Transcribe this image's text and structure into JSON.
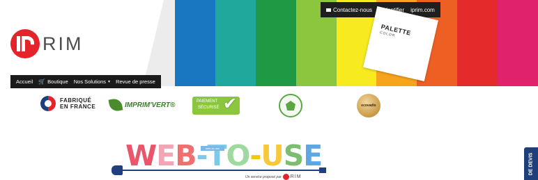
{
  "top_bar": {
    "contact": "Contactez-nous",
    "login": "S'identifier",
    "site": "iprim.com"
  },
  "logo": {
    "text": "RIM"
  },
  "palette": {
    "title": "PALETTE",
    "subtitle": "COLOR"
  },
  "stripe_colors": [
    "#1976c0",
    "#1fa89c",
    "#1f9943",
    "#8cc63f",
    "#f7ea1f",
    "#f7a41d",
    "#ee5f24",
    "#e42a2a",
    "#e0226a"
  ],
  "nav": {
    "items": [
      {
        "label": "Accueil"
      },
      {
        "label": "Boutique",
        "icon": "cart-icon"
      },
      {
        "label": "Nos Solutions",
        "icon": "caret-down-icon"
      },
      {
        "label": "Revue de presse"
      }
    ]
  },
  "badges": {
    "fabrique": "FABRIQUÉ\nEN FRANCE",
    "fabrique_l1": "FABRIQUÉ",
    "fabrique_l2": "EN FRANCE",
    "imprim_vert": "IMPRIM'VERT®",
    "paiement_l1": "PAIEMENT",
    "paiement_l2": "SÉCURISÉ",
    "ecovadis": "ecovadis"
  },
  "web_to_use": {
    "letters": [
      {
        "ch": "W",
        "color": "#e9556a"
      },
      {
        "ch": "E",
        "color": "#f2a5b4"
      },
      {
        "ch": "B",
        "color": "#f06f6f"
      },
      {
        "ch": "-",
        "color": "#7cc9e8"
      },
      {
        "ch": "T",
        "color": "#7cc9e8"
      },
      {
        "ch": "O",
        "color": "#9edaa0"
      },
      {
        "ch": "-",
        "color": "#f0c419"
      },
      {
        "ch": "U",
        "color": "#f7c83a"
      },
      {
        "ch": "S",
        "color": "#7dbd6f"
      },
      {
        "ch": "E",
        "color": "#5fa7e0"
      }
    ],
    "small_label": "web-to-use",
    "tagline": "Un service proposé par",
    "brand": "RIM"
  },
  "side_tab": {
    "label": "DE DEVIS"
  }
}
